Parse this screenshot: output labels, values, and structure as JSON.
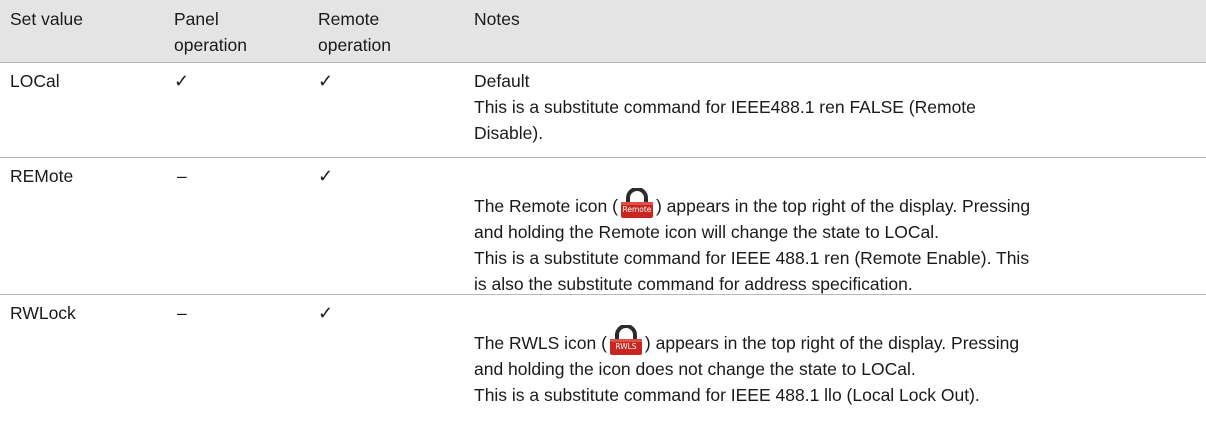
{
  "header": {
    "set_value": "Set value",
    "panel_line1": "Panel",
    "panel_line2": "operation",
    "remote_line1": "Remote",
    "remote_line2": "operation",
    "notes": "Notes"
  },
  "rows": [
    {
      "set_value": "LOCal",
      "panel": "✓",
      "remote": "✓",
      "notes": [
        "Default",
        "This is a substitute command for IEEE488.1 ren FALSE (Remote",
        "Disable)."
      ]
    },
    {
      "set_value": "REMote",
      "panel": "–",
      "remote": "✓",
      "icon_label": "Remote",
      "notes_before_icon": "The Remote icon (",
      "notes_after_icon": ") appears in the top right of the display. Pressing",
      "notes": [
        "and holding the Remote icon will change the state to LOCal.",
        "This is a substitute command for IEEE 488.1 ren (Remote Enable). This",
        "is also the substitute command for address specification."
      ]
    },
    {
      "set_value": "RWLock",
      "panel": "–",
      "remote": "✓",
      "icon_label": "RWLS",
      "notes_before_icon": "The RWLS icon (",
      "notes_after_icon": ") appears in the top right of the display. Pressing",
      "notes": [
        "and holding the icon does not change the state to LOCal.",
        "This is a substitute command for IEEE 488.1 llo (Local Lock Out)."
      ]
    }
  ],
  "colors": {
    "header_bg": "#e4e4e4",
    "row_border": "#b8b8b8",
    "lock_body": "#c8261e",
    "lock_shackle": "#2b2b2b"
  },
  "icons": [
    "remote-lock-icon",
    "rwls-lock-icon"
  ]
}
